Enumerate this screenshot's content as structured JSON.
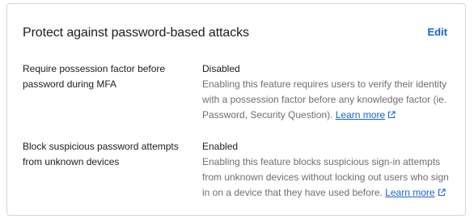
{
  "card": {
    "title": "Protect against password-based attacks",
    "edit_label": "Edit"
  },
  "settings": [
    {
      "label": "Require possession factor before password during MFA",
      "status": "Disabled",
      "description": "Enabling this feature requires users to verify their identity with a possession factor before any knowledge factor (ie. Password, Security Question).",
      "link_label": "Learn more"
    },
    {
      "label": "Block suspicious password attempts from unknown devices",
      "status": "Enabled",
      "description": "Enabling this feature blocks suspicious sign-in attempts from unknown devices without locking out users who sign in on a device that they have used before.",
      "link_label": "Learn more"
    }
  ],
  "colors": {
    "link": "#1662dd",
    "text": "#1d1d21",
    "muted": "#6e6e78",
    "border": "#d7d7dc"
  },
  "icons": {
    "external_link": "external-link-icon"
  }
}
